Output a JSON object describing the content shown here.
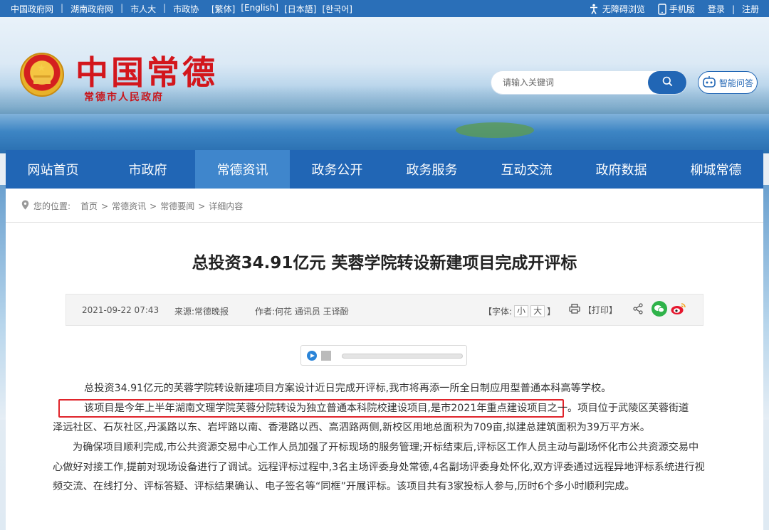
{
  "topbar": {
    "links": [
      "中国政府网",
      "湖南政府网",
      "市人大",
      "市政协"
    ],
    "languages": [
      "[繁体]",
      "[English]",
      "[日本語]",
      "[한국어]"
    ],
    "accessibility": "无障碍浏览",
    "mobile": "手机版",
    "login": "登录",
    "register": "注册"
  },
  "header": {
    "title": "中国常德",
    "subtitle": "常德市人民政府",
    "search_placeholder": "请输入关键词",
    "ai_label": "智能问答"
  },
  "nav": {
    "items": [
      "网站首页",
      "市政府",
      "常德资讯",
      "政务公开",
      "政务服务",
      "互动交流",
      "政府数据",
      "柳城常德"
    ],
    "active_index": 2
  },
  "breadcrumb": {
    "label": "您的位置:",
    "items": [
      "首页",
      "常德资讯",
      "常德要闻",
      "详细内容"
    ]
  },
  "article": {
    "title": "总投资34.91亿元 芙蓉学院转设新建项目完成开评标",
    "date": "2021-09-22 07:43",
    "source": "来源:常德晚报",
    "author": "作者:何花 通讯员 王译酚",
    "font_label": "【字体:",
    "font_small": "小",
    "font_large": "大",
    "font_close": "】",
    "print_label": "【打印】",
    "paragraph1": "总投资34.91亿元的芙蓉学院转设新建项目方案设计近日完成开评标,我市将再添一所全日制应用型普通本科高等学校。",
    "paragraph2_highlight": "该项目是今年上半年湖南文理学院芙蓉分院转设为独立普通本科院校建设项目,是市2021年重点建设项目之一。",
    "paragraph2_rest_a": "项目位于武陵区芙蓉街道",
    "paragraph2_rest_b": "泽远社区、石灰社区,丹溪路以东、岩坪路以南、香港路以西、高泗路两侧,新校区用地总面积为709亩,拟建总建筑面积为39万平方米。",
    "paragraph3": "为确保项目顺利完成,市公共资源交易中心工作人员加强了开标现场的服务管理;开标结束后,评标区工作人员主动与副场怀化市公共资源交易中心做好对接工作,提前对现场设备进行了调试。远程评标过程中,3名主场评委身处常德,4名副场评委身处怀化,双方评委通过远程异地评标系统进行视频交流、在线打分、评标答疑、评标结果确认、电子签名等“同框”开展评标。该项目共有3家投标人参与,历时6个多小时顺利完成。"
  },
  "colors": {
    "brand_blue": "#2166b5",
    "active_nav": "#3f86cc",
    "logo_red": "#d3161c",
    "highlight_red": "#e0242b"
  },
  "icons": [
    "accessibility-icon",
    "mobile-icon",
    "search-icon",
    "robot-icon",
    "location-pin-icon",
    "printer-icon",
    "share-icon",
    "wechat-icon",
    "weibo-icon",
    "play-icon",
    "stop-icon"
  ]
}
